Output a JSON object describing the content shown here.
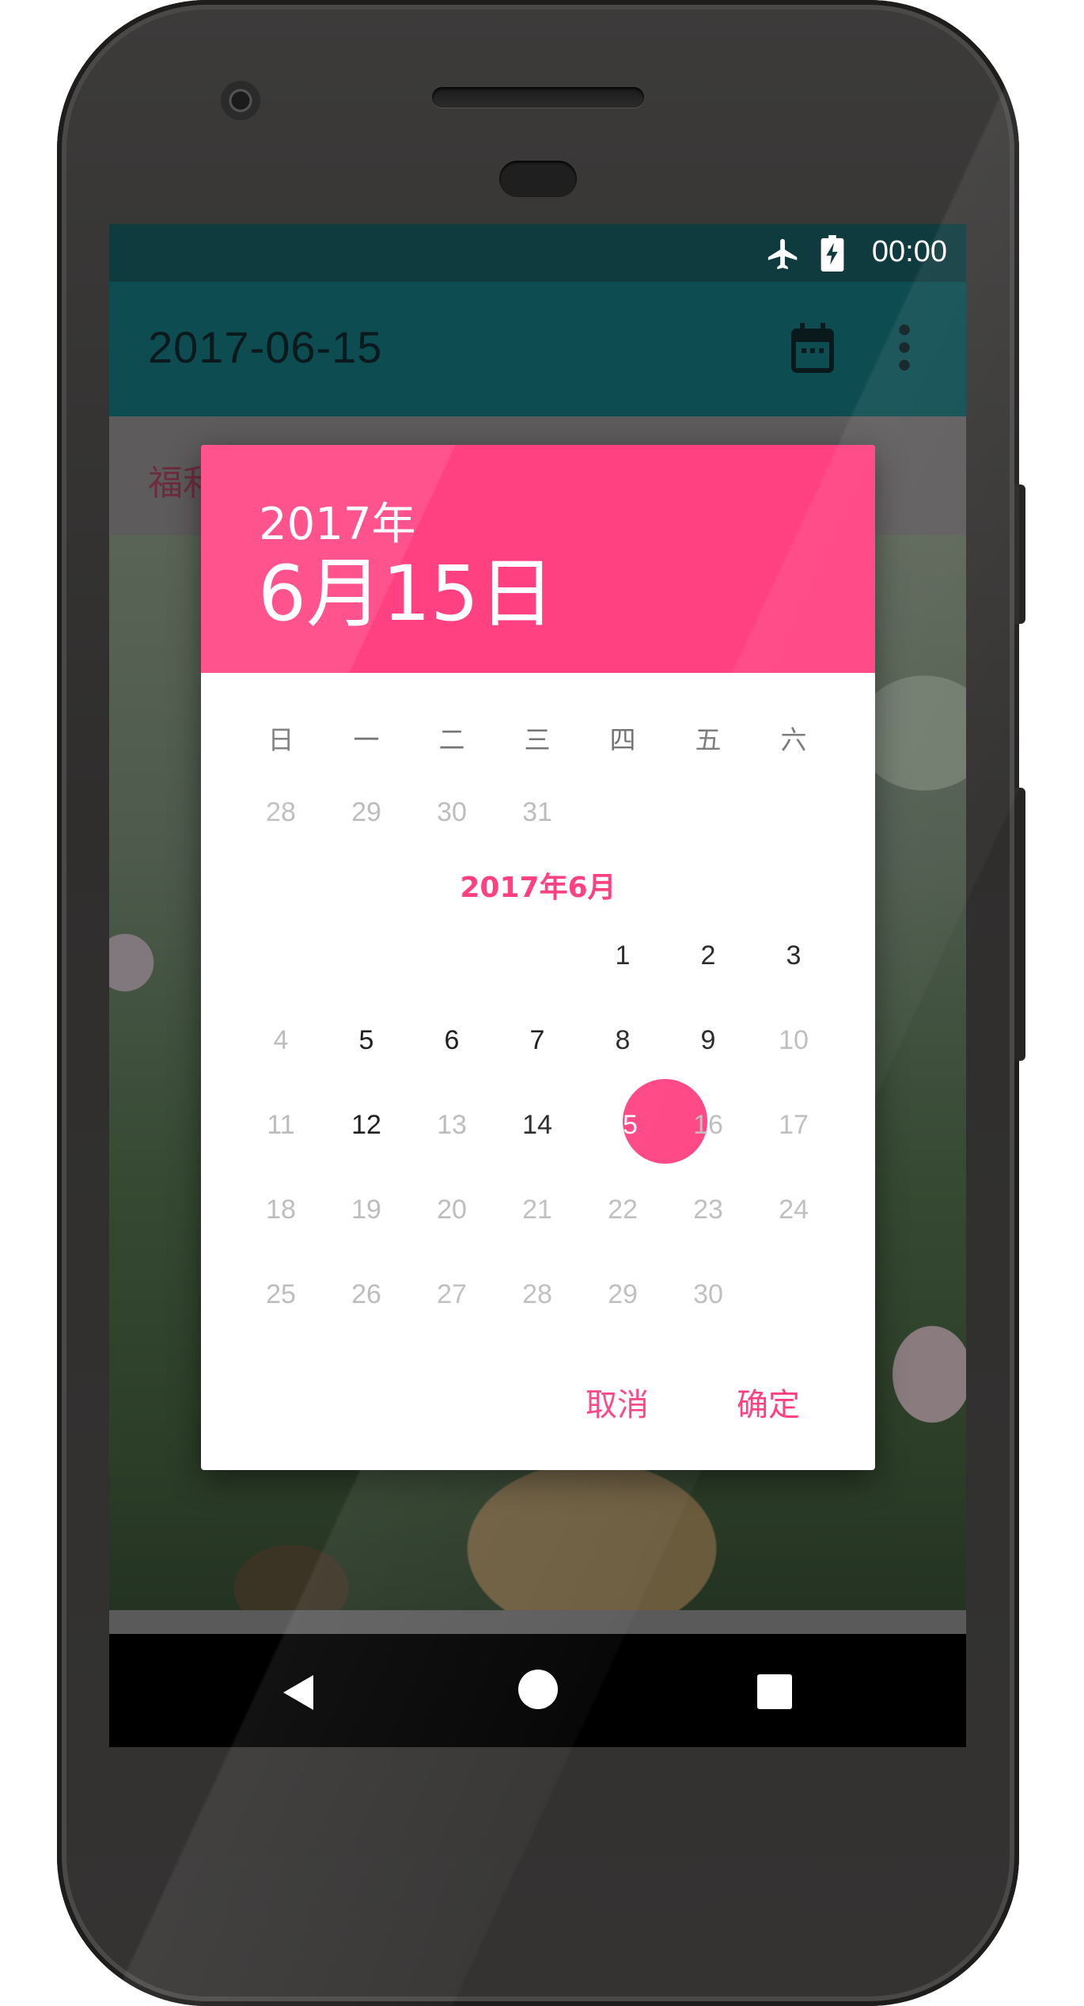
{
  "status_bar": {
    "time": "00:00",
    "icons": [
      "airplane-icon",
      "battery-charging-icon"
    ]
  },
  "app_bar": {
    "title": "2017-06-15",
    "icons": [
      "calendar-icon",
      "more-vert-icon"
    ]
  },
  "subheader": {
    "text": "福利"
  },
  "dialog": {
    "year": "2017年",
    "date": "6月15日",
    "accent_color": "#ff4081",
    "weekdays": [
      "日",
      "一",
      "二",
      "三",
      "四",
      "五",
      "六"
    ],
    "prev_month_days": [
      "28",
      "29",
      "30",
      "31"
    ],
    "month_label": "2017年6月",
    "weeks": [
      [
        "",
        "",
        "",
        "",
        "1",
        "2",
        "3"
      ],
      [
        "4",
        "5",
        "6",
        "7",
        "8",
        "9",
        "10"
      ],
      [
        "11",
        "12",
        "13",
        "14",
        "15",
        "16",
        "17"
      ],
      [
        "18",
        "19",
        "20",
        "21",
        "22",
        "23",
        "24"
      ],
      [
        "25",
        "26",
        "27",
        "28",
        "29",
        "30",
        ""
      ]
    ],
    "selected_day": "15",
    "cancel_label": "取消",
    "confirm_label": "确定"
  },
  "nav_bar": {
    "icons": [
      "back-icon",
      "home-icon",
      "recents-icon"
    ]
  }
}
